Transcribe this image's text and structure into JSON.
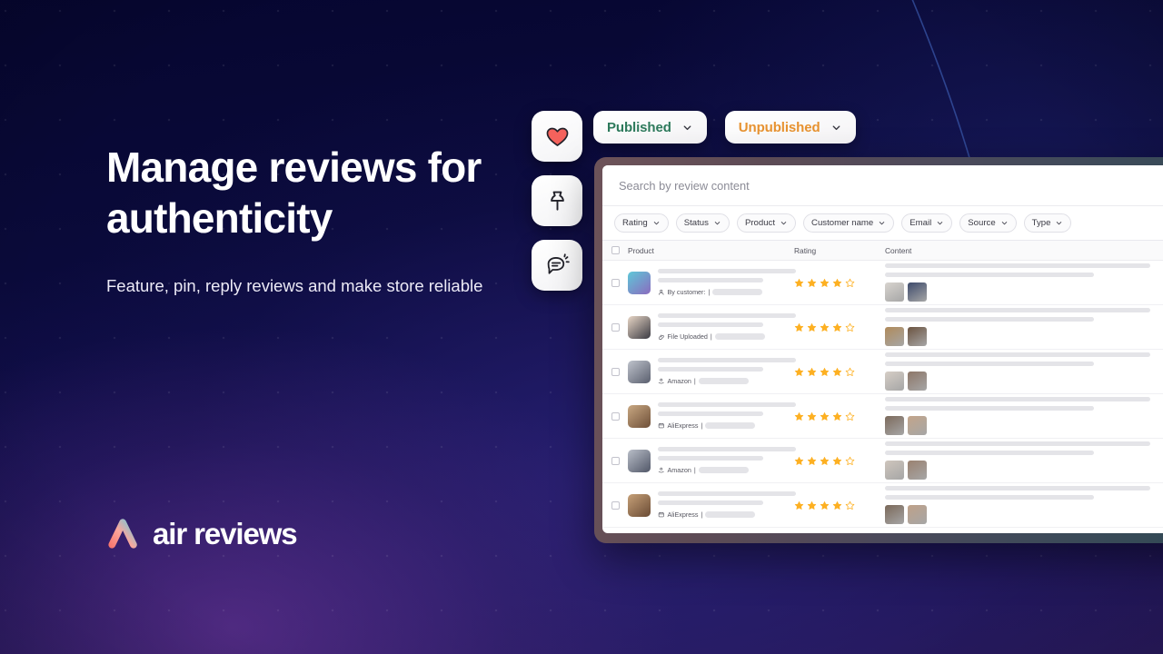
{
  "hero": {
    "headline": "Manage reviews for authenticity",
    "subhead": "Feature, pin, reply reviews and make store reliable"
  },
  "logo": {
    "wordmark": "air reviews",
    "mark_icon": "air-logo-mark",
    "gradient_from": "#F8736B",
    "gradient_to": "#4FD1EC"
  },
  "fabs": [
    {
      "name": "feature-review",
      "icon": "heart-icon",
      "color": "#F4625C"
    },
    {
      "name": "pin-review",
      "icon": "pushpin-icon",
      "color": "#22222A"
    },
    {
      "name": "reply-review",
      "icon": "chat-reply-icon",
      "color": "#22222A"
    }
  ],
  "pills": [
    {
      "label": "Published",
      "color": "#2E7A5C",
      "icon": "chevron-down-icon"
    },
    {
      "label": "Unpublished",
      "color": "#E79230",
      "icon": "chevron-down-icon"
    }
  ],
  "panel": {
    "search": {
      "placeholder": "Search by review content",
      "value": ""
    },
    "filters": [
      {
        "label": "Rating",
        "icon": "chevron-down-icon"
      },
      {
        "label": "Status",
        "icon": "chevron-down-icon"
      },
      {
        "label": "Product",
        "icon": "chevron-down-icon"
      },
      {
        "label": "Customer name",
        "icon": "chevron-down-icon"
      },
      {
        "label": "Email",
        "icon": "chevron-down-icon"
      },
      {
        "label": "Source",
        "icon": "chevron-down-icon"
      },
      {
        "label": "Type",
        "icon": "chevron-down-icon"
      }
    ],
    "table": {
      "columns": [
        "Product",
        "Rating",
        "Content"
      ],
      "select_all_icon": "checkbox-icon",
      "rows": [
        {
          "source_label": "By customer:",
          "source_icon": "person-icon",
          "rating": 4,
          "max_rating": 5,
          "thumb_colors": [
            "#5ec8d8",
            "#8b6bbf"
          ],
          "content_images": [
            "#d8d4cf",
            "#3d4a6b"
          ]
        },
        {
          "source_label": "File Uploaded",
          "source_icon": "paperclip-icon",
          "rating": 4,
          "max_rating": 5,
          "thumb_colors": [
            "#e8d6c6",
            "#3a3a42"
          ],
          "content_images": [
            "#b08a5a",
            "#6b5340"
          ]
        },
        {
          "source_label": "Amazon",
          "source_icon": "amazon-icon",
          "rating": 4,
          "max_rating": 5,
          "thumb_colors": [
            "#bfc3cc",
            "#5a5f6e"
          ],
          "content_images": [
            "#d6cec6",
            "#8d7668"
          ]
        },
        {
          "source_label": "AliExpress",
          "source_icon": "aliexpress-icon",
          "rating": 4,
          "max_rating": 5,
          "thumb_colors": [
            "#c9a882",
            "#6e4f38"
          ],
          "content_images": [
            "#7c6a5c",
            "#c3a58a"
          ]
        },
        {
          "source_label": "Amazon",
          "source_icon": "amazon-icon",
          "rating": 4,
          "max_rating": 5,
          "thumb_colors": [
            "#b9bec8",
            "#515768"
          ],
          "content_images": [
            "#cfc6bd",
            "#9a8170"
          ]
        },
        {
          "source_label": "AliExpress",
          "source_icon": "aliexpress-icon",
          "rating": 4,
          "max_rating": 5,
          "thumb_colors": [
            "#c6a078",
            "#6a4b34"
          ],
          "content_images": [
            "#7a6859",
            "#bfa188"
          ]
        }
      ],
      "separator": "|"
    }
  },
  "theme": {
    "star_filled": "#FDB022",
    "star_empty": "#FDB022",
    "bg_navy": "#080833",
    "panel_bg": "#ffffff"
  }
}
